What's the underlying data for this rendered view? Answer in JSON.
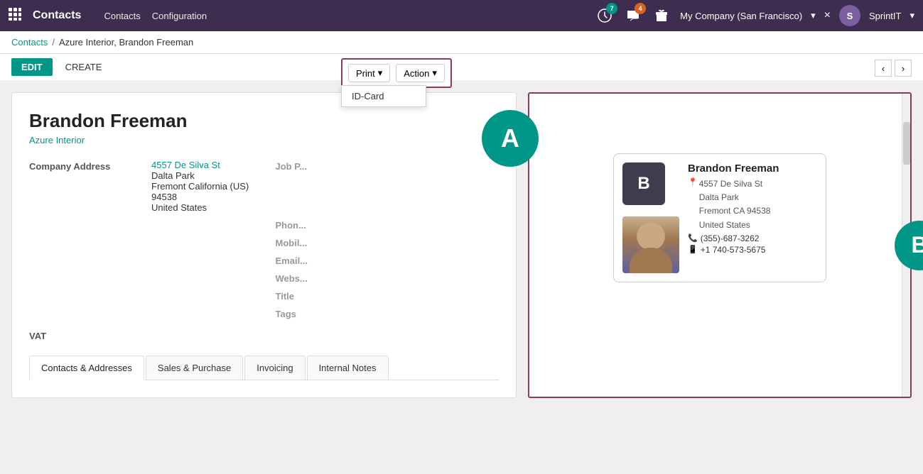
{
  "app": {
    "name": "Contacts",
    "grid_icon": "⊞"
  },
  "topbar": {
    "nav_items": [
      "Contacts",
      "Configuration"
    ],
    "badge_clock": "7",
    "badge_chat": "4",
    "company": "My Company (San Francisco)",
    "close_icon": "×",
    "username": "SprintIT",
    "avatar_initials": "S"
  },
  "breadcrumb": {
    "parent": "Contacts",
    "separator": "/",
    "current": "Azure Interior, Brandon Freeman"
  },
  "toolbar": {
    "edit_label": "EDIT",
    "create_label": "CREATE",
    "print_label": "Print",
    "action_label": "Action",
    "dropdown_arrow": "▾",
    "menu_item": "ID-Card",
    "prev_icon": "‹",
    "next_icon": "›"
  },
  "contact": {
    "name": "Brandon Freeman",
    "company": "Azure Interior",
    "avatar_letter": "A",
    "fields": {
      "company_address_label": "Company Address",
      "company_address_value": "4557 De Silva St",
      "address_line2": "Dalta Park",
      "address_line3": "Fremont  California (US)  94538",
      "address_line4": "United States",
      "job_position_label": "Job P...",
      "phone_label": "Phon...",
      "mobile_label": "Mobil...",
      "email_label": "Email...",
      "website_label": "Webs...",
      "title_label": "Title",
      "tags_label": "Tags",
      "vat_label": "VAT"
    }
  },
  "tabs": [
    {
      "id": "contacts",
      "label": "Contacts & Addresses",
      "active": true
    },
    {
      "id": "sales",
      "label": "Sales & Purchase"
    },
    {
      "id": "invoicing",
      "label": "Invoicing"
    },
    {
      "id": "notes",
      "label": "Internal Notes"
    }
  ],
  "id_card": {
    "logo_letter": "B",
    "name": "Brandon Freeman",
    "address_pin": "📍",
    "address_line1": "4557 De Silva St",
    "address_line2": "Dalta Park",
    "address_line3": "Fremont CA 94538",
    "address_line4": "United States",
    "phone_icon": "📞",
    "phone": "(355)-687-3262",
    "mobile_icon": "📱",
    "mobile": "+1 740-573-5675"
  },
  "b_circle": "B",
  "colors": {
    "primary": "#009688",
    "accent": "#8b3a5a",
    "topbar": "#3d2d4e"
  }
}
